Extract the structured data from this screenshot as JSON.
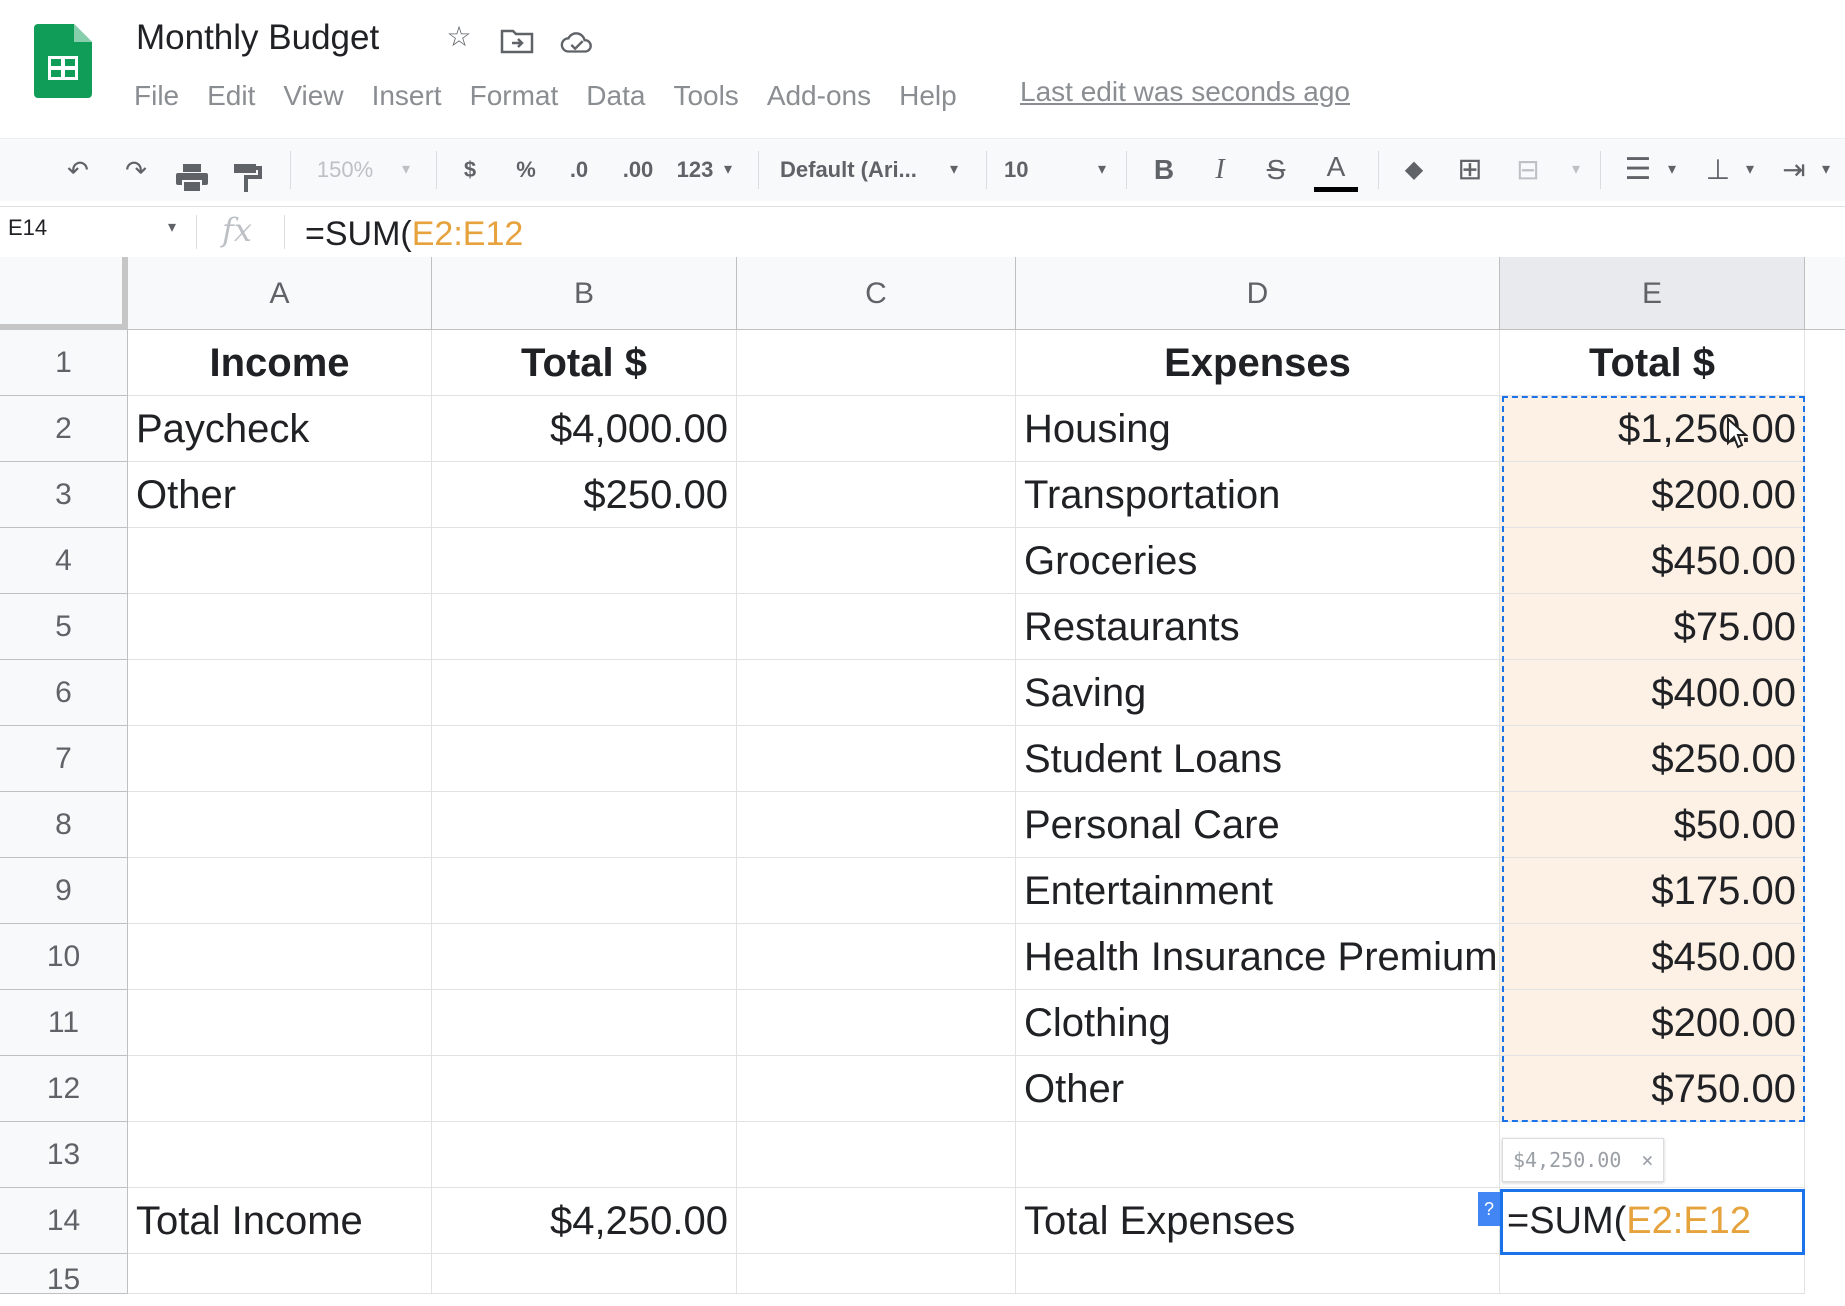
{
  "app": {
    "doc_title": "Monthly Budget",
    "logo_icon": "sheets-logo-icon",
    "menu": [
      "File",
      "Edit",
      "View",
      "Insert",
      "Format",
      "Data",
      "Tools",
      "Add-ons",
      "Help"
    ],
    "last_edit": "Last edit was seconds ago"
  },
  "toolbar": {
    "zoom": "150%",
    "currency": "$",
    "percent": "%",
    "decrease_decimals": ".0",
    "increase_decimals": ".00",
    "more_formats": "123",
    "font": "Default (Ari...",
    "font_size": "10",
    "bold": "B",
    "italic": "I",
    "strike": "S",
    "text_color": "A"
  },
  "formula_bar": {
    "name_box": "E14",
    "fx": "fx",
    "prefix": "=SUM(",
    "range": "E2:E12"
  },
  "columns": [
    "A",
    "B",
    "C",
    "D",
    "E"
  ],
  "rows": [
    "1",
    "2",
    "3",
    "4",
    "5",
    "6",
    "7",
    "8",
    "9",
    "10",
    "11",
    "12",
    "13",
    "14",
    "15"
  ],
  "cells": {
    "A1": "Income",
    "B1": "Total $",
    "D1": "Expenses",
    "E1": "Total $",
    "A2": "Paycheck",
    "B2": "$4,000.00",
    "D2": "Housing",
    "E2": "$1,250.00",
    "A3": "Other",
    "B3": "$250.00",
    "D3": "Transportation",
    "E3": "$200.00",
    "D4": "Groceries",
    "E4": "$450.00",
    "D5": "Restaurants",
    "E5": "$75.00",
    "D6": "Saving",
    "E6": "$400.00",
    "D7": "Student Loans",
    "E7": "$250.00",
    "D8": "Personal Care",
    "E8": "$50.00",
    "D9": "Entertainment",
    "E9": "$175.00",
    "D10": "Health Insurance Premium",
    "E10": "$450.00",
    "D11": "Clothing",
    "E11": "$200.00",
    "D12": "Other",
    "E12": "$750.00",
    "A14": "Total Income",
    "B14": "$4,250.00",
    "D14": "Total Expenses"
  },
  "editor": {
    "prefix": "=SUM(",
    "range": "E2:E12",
    "preview": "$4,250.00",
    "preview_close": "×",
    "help": "?"
  },
  "colors": {
    "accent_blue": "#1a73e8",
    "range_highlight": "#fdf1e6",
    "range_text": "#e6a23c",
    "logo_green": "#0f9d58"
  }
}
